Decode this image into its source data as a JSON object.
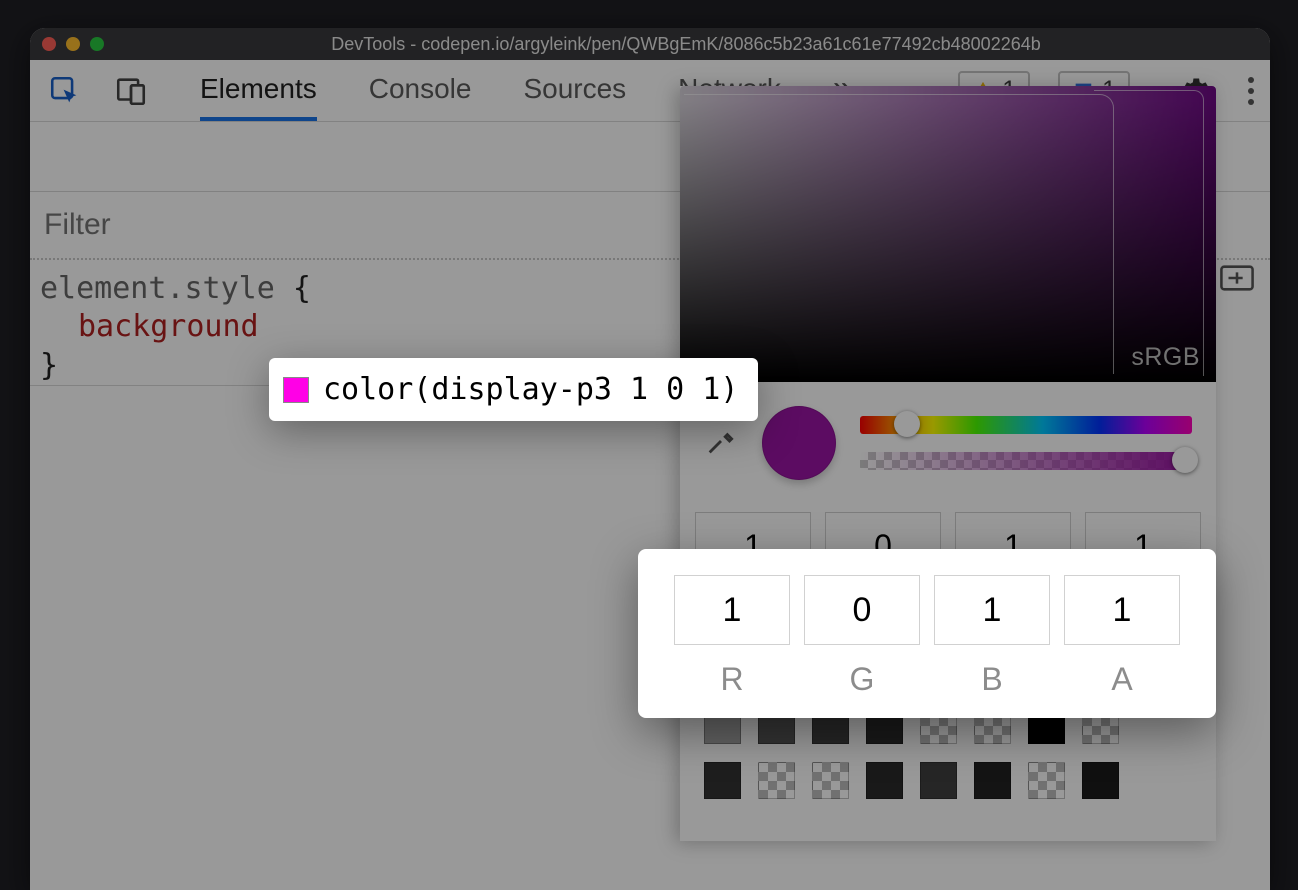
{
  "window": {
    "title": "DevTools - codepen.io/argyleink/pen/QWBgEmK/8086c5b23a61c61e77492cb48002264b"
  },
  "toolbar": {
    "tabs": [
      "Elements",
      "Console",
      "Sources",
      "Network"
    ],
    "active_tab": 0,
    "more_glyph": "»",
    "warnings": "1",
    "messages": "1"
  },
  "styles": {
    "filter_placeholder": "Filter",
    "selector": "element.style",
    "brace_open": "{",
    "property": "background",
    "brace_close": "}"
  },
  "tooltip": {
    "value": "color(display-p3 1 0 1)",
    "swatch_color": "#ff00e6"
  },
  "picker": {
    "gamut_label": "sRGB",
    "preview_color": "#9a14a3",
    "channels": [
      {
        "label": "R",
        "value": "1"
      },
      {
        "label": "G",
        "value": "0"
      },
      {
        "label": "B",
        "value": "1"
      },
      {
        "label": "A",
        "value": "1"
      }
    ],
    "palette": [
      [
        "#a094d8",
        "#000000",
        "#262626",
        "#e5c91f",
        "#d4b31b",
        "outline",
        "outline",
        "#a3a3a3"
      ],
      [
        "#a3a3a3",
        "#555555",
        "#3f3f3f",
        "#2b2b2b",
        "checker",
        "checker",
        "#000000",
        "checker"
      ],
      [
        "#333333",
        "checker",
        "checker",
        "#2a2a2a",
        "#404040",
        "#222222",
        "checker",
        "#1c1c1c"
      ]
    ]
  }
}
